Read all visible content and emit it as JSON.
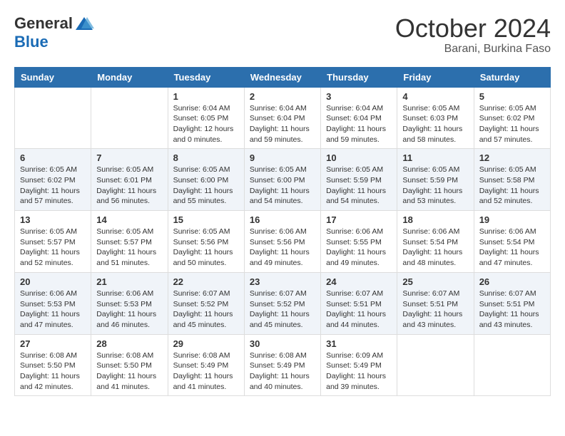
{
  "header": {
    "logo_general": "General",
    "logo_blue": "Blue",
    "month_title": "October 2024",
    "location": "Barani, Burkina Faso"
  },
  "weekdays": [
    "Sunday",
    "Monday",
    "Tuesday",
    "Wednesday",
    "Thursday",
    "Friday",
    "Saturday"
  ],
  "weeks": [
    [
      {
        "day": "",
        "info": ""
      },
      {
        "day": "",
        "info": ""
      },
      {
        "day": "1",
        "info": "Sunrise: 6:04 AM\nSunset: 6:05 PM\nDaylight: 12 hours\nand 0 minutes."
      },
      {
        "day": "2",
        "info": "Sunrise: 6:04 AM\nSunset: 6:04 PM\nDaylight: 11 hours\nand 59 minutes."
      },
      {
        "day": "3",
        "info": "Sunrise: 6:04 AM\nSunset: 6:04 PM\nDaylight: 11 hours\nand 59 minutes."
      },
      {
        "day": "4",
        "info": "Sunrise: 6:05 AM\nSunset: 6:03 PM\nDaylight: 11 hours\nand 58 minutes."
      },
      {
        "day": "5",
        "info": "Sunrise: 6:05 AM\nSunset: 6:02 PM\nDaylight: 11 hours\nand 57 minutes."
      }
    ],
    [
      {
        "day": "6",
        "info": "Sunrise: 6:05 AM\nSunset: 6:02 PM\nDaylight: 11 hours\nand 57 minutes."
      },
      {
        "day": "7",
        "info": "Sunrise: 6:05 AM\nSunset: 6:01 PM\nDaylight: 11 hours\nand 56 minutes."
      },
      {
        "day": "8",
        "info": "Sunrise: 6:05 AM\nSunset: 6:00 PM\nDaylight: 11 hours\nand 55 minutes."
      },
      {
        "day": "9",
        "info": "Sunrise: 6:05 AM\nSunset: 6:00 PM\nDaylight: 11 hours\nand 54 minutes."
      },
      {
        "day": "10",
        "info": "Sunrise: 6:05 AM\nSunset: 5:59 PM\nDaylight: 11 hours\nand 54 minutes."
      },
      {
        "day": "11",
        "info": "Sunrise: 6:05 AM\nSunset: 5:59 PM\nDaylight: 11 hours\nand 53 minutes."
      },
      {
        "day": "12",
        "info": "Sunrise: 6:05 AM\nSunset: 5:58 PM\nDaylight: 11 hours\nand 52 minutes."
      }
    ],
    [
      {
        "day": "13",
        "info": "Sunrise: 6:05 AM\nSunset: 5:57 PM\nDaylight: 11 hours\nand 52 minutes."
      },
      {
        "day": "14",
        "info": "Sunrise: 6:05 AM\nSunset: 5:57 PM\nDaylight: 11 hours\nand 51 minutes."
      },
      {
        "day": "15",
        "info": "Sunrise: 6:05 AM\nSunset: 5:56 PM\nDaylight: 11 hours\nand 50 minutes."
      },
      {
        "day": "16",
        "info": "Sunrise: 6:06 AM\nSunset: 5:56 PM\nDaylight: 11 hours\nand 49 minutes."
      },
      {
        "day": "17",
        "info": "Sunrise: 6:06 AM\nSunset: 5:55 PM\nDaylight: 11 hours\nand 49 minutes."
      },
      {
        "day": "18",
        "info": "Sunrise: 6:06 AM\nSunset: 5:54 PM\nDaylight: 11 hours\nand 48 minutes."
      },
      {
        "day": "19",
        "info": "Sunrise: 6:06 AM\nSunset: 5:54 PM\nDaylight: 11 hours\nand 47 minutes."
      }
    ],
    [
      {
        "day": "20",
        "info": "Sunrise: 6:06 AM\nSunset: 5:53 PM\nDaylight: 11 hours\nand 47 minutes."
      },
      {
        "day": "21",
        "info": "Sunrise: 6:06 AM\nSunset: 5:53 PM\nDaylight: 11 hours\nand 46 minutes."
      },
      {
        "day": "22",
        "info": "Sunrise: 6:07 AM\nSunset: 5:52 PM\nDaylight: 11 hours\nand 45 minutes."
      },
      {
        "day": "23",
        "info": "Sunrise: 6:07 AM\nSunset: 5:52 PM\nDaylight: 11 hours\nand 45 minutes."
      },
      {
        "day": "24",
        "info": "Sunrise: 6:07 AM\nSunset: 5:51 PM\nDaylight: 11 hours\nand 44 minutes."
      },
      {
        "day": "25",
        "info": "Sunrise: 6:07 AM\nSunset: 5:51 PM\nDaylight: 11 hours\nand 43 minutes."
      },
      {
        "day": "26",
        "info": "Sunrise: 6:07 AM\nSunset: 5:51 PM\nDaylight: 11 hours\nand 43 minutes."
      }
    ],
    [
      {
        "day": "27",
        "info": "Sunrise: 6:08 AM\nSunset: 5:50 PM\nDaylight: 11 hours\nand 42 minutes."
      },
      {
        "day": "28",
        "info": "Sunrise: 6:08 AM\nSunset: 5:50 PM\nDaylight: 11 hours\nand 41 minutes."
      },
      {
        "day": "29",
        "info": "Sunrise: 6:08 AM\nSunset: 5:49 PM\nDaylight: 11 hours\nand 41 minutes."
      },
      {
        "day": "30",
        "info": "Sunrise: 6:08 AM\nSunset: 5:49 PM\nDaylight: 11 hours\nand 40 minutes."
      },
      {
        "day": "31",
        "info": "Sunrise: 6:09 AM\nSunset: 5:49 PM\nDaylight: 11 hours\nand 39 minutes."
      },
      {
        "day": "",
        "info": ""
      },
      {
        "day": "",
        "info": ""
      }
    ]
  ]
}
